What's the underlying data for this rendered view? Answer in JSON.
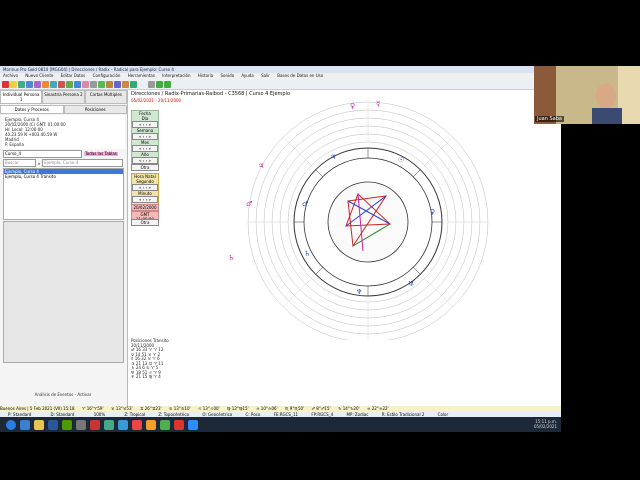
{
  "app": {
    "title": "Morinus Pro Gold 0810 [MGG04] | Direcciones / Radix - Radical para Ejemplo: Curso 4",
    "menu": [
      "Archivo",
      "Nuevo Cliente",
      "Editar Datos",
      "Configuración",
      "Herramientas",
      "Interpretación",
      "Historia",
      "Sonido",
      "Ayuda",
      "Salir",
      "Bases de Datos en Uso"
    ]
  },
  "left_panel": {
    "tabs_top": [
      "Individual Persona 1",
      "Sinastría Persona 2",
      "Cartas Múltiples"
    ],
    "tabs_sub": [
      "Datos y Procesos",
      "Posiciones"
    ],
    "info_lines": [
      "Ejemplo, Curso 4",
      "20/02/2000 (C)  GMT: 01:00:00",
      "Hr. Local: 12:00:00",
      "40.23.59 N +003.40.59 W",
      "Madrid",
      "P. España"
    ],
    "select_value": "Curso_4",
    "tables_label": "Todas las Tablas",
    "search_placeholder": "Buscar",
    "search2_placeholder": "Ejemplo, Curso 4",
    "list_items": [
      "Ejemplo, Curso 4",
      "Ejemplo, Curso 4 Tránsito"
    ],
    "events_button": "Análisis de Eventos - Activar"
  },
  "main": {
    "chart_title": "Direcciones / Radix-Primarias-Raíbod - C3568 | Curso 4 Ejemplo",
    "dates": "05/02/2021 - 20/11/2000",
    "controls": {
      "groups": [
        "Fecha",
        "Día",
        "Semana",
        "Mes",
        "Año"
      ],
      "otra1": "Otra",
      "hora_natal": "Hora Natal",
      "segundo": "Segundo",
      "minuto": "Minuto",
      "date_value": "20/02/2000",
      "gmt_value": "GMT 11:00:00",
      "otra2": "Otra"
    },
    "positions_title": "Posiciones Tránsito",
    "positions_date": "20/11/2000",
    "positions_rows": [
      "♂ 16 33 ♈ ♈ 12",
      "♀ 14 51 ♉ ♈ 2",
      "☿ 16 32 ♉ ♈ 6",
      "♃ 21 13 ♊ ♈ 11",
      "♄ 24 6 ♋ ♈ 5",
      "♅ 18 51 ♌ ♈ 9",
      "♆ 21 15 ♍ ♈ 4"
    ]
  },
  "status_bar": [
    "Buenos Aires  |  5 Feb 2021 (VII) 15:18",
    "♈ 16°♈59'",
    "♉ 13°♉53'",
    "♊ 26°♊23'",
    "♋ 13°♋10'",
    "♌ 13°♌00'",
    "♍ 12°♍15'",
    "♎ 10°♎06'",
    "♏ 9°♏50'",
    "♐ 8°♐15'",
    "♑ 14°♑20'",
    "♒ 22°♒22'"
  ],
  "status_bar2": [
    "P: Standard",
    "D: Standard",
    "100%",
    "Z: Tropical",
    "Z: Topocéntrico",
    "O: Geocéntrico",
    "C: Poco",
    "FE:RGCS_11",
    "FP:RGCS_4",
    "MP: Zodiac",
    "R: Estilo Tradicional 2",
    "Color"
  ],
  "taskbar": {
    "time": "15:11 p.m.",
    "date": "05/02/2021"
  },
  "webcam": {
    "name": "Juan Saba"
  },
  "colors": {
    "accent": "#3c78d8",
    "chart_red": "#cc2222",
    "chart_blue": "#2244cc",
    "chart_green": "#228822",
    "chart_magenta": "#cc22aa"
  }
}
